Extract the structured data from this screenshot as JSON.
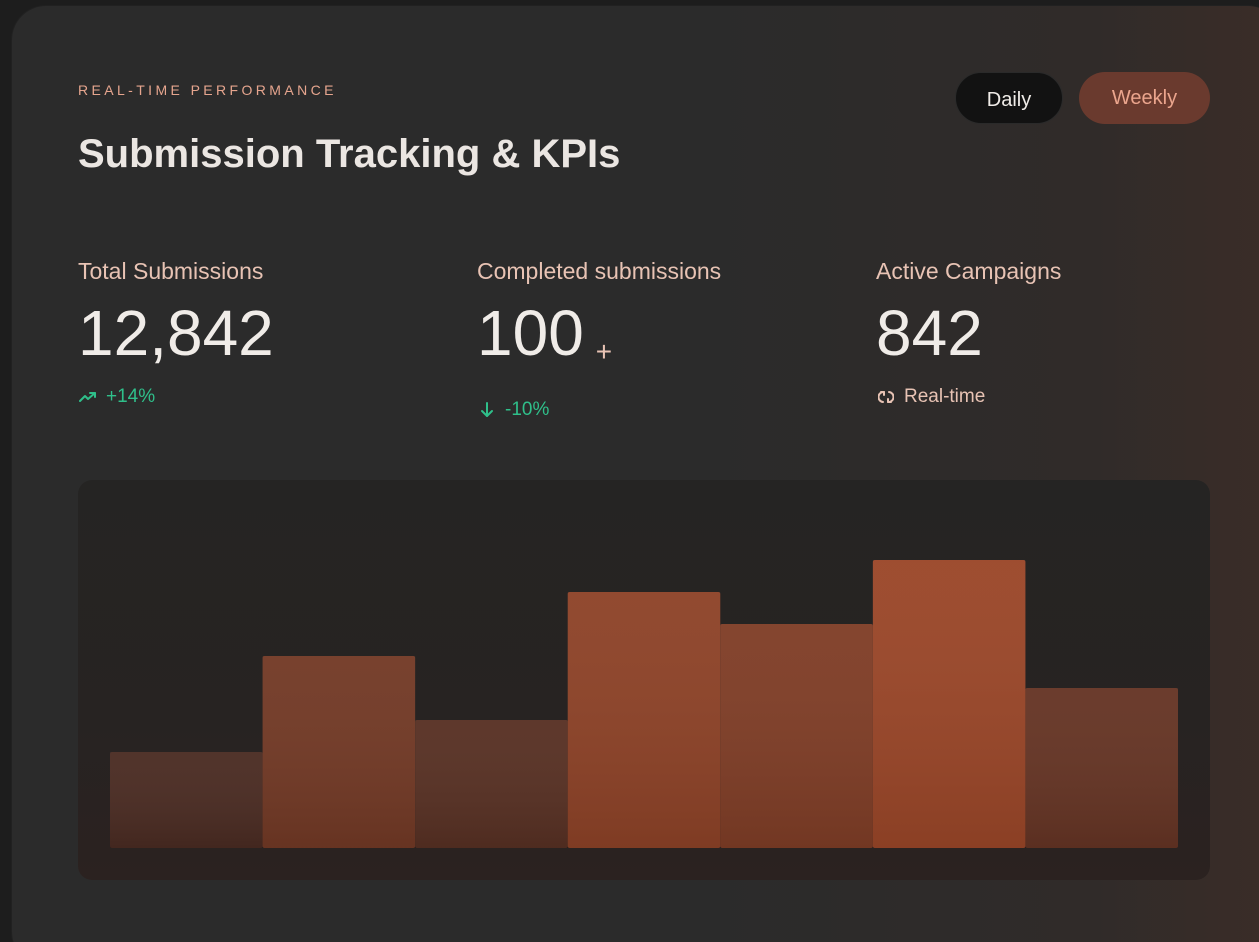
{
  "header": {
    "eyebrow": "REAL-TIME PERFORMANCE",
    "title": "Submission Tracking & KPIs"
  },
  "toggles": [
    {
      "label": "Daily",
      "selected": false
    },
    {
      "label": "Weekly",
      "selected": true
    }
  ],
  "kpis": [
    {
      "label": "Total Submissions",
      "value": "12,842",
      "suffix": "",
      "trend": "+14%",
      "trend_icon": "trending-up-icon",
      "trend_color": "#2fbf8a"
    },
    {
      "label": "Completed submissions",
      "value": "100",
      "suffix": "+",
      "trend": "-10%",
      "trend_icon": "arrow-down-icon",
      "trend_color": "#2fbf8a"
    },
    {
      "label": "Active Campaigns",
      "value": "842",
      "suffix": "",
      "trend": "Real-time",
      "trend_icon": "refresh-icon",
      "trend_color": "#e8c3b4"
    }
  ],
  "colors": {
    "accent": "#e6a58e",
    "bar_base": "#4a2b22",
    "bar_peak": "#9a4628",
    "positive": "#2fbf8a"
  },
  "chart_data": {
    "type": "bar",
    "categories": [
      "",
      "",
      "",
      "",
      "",
      "",
      ""
    ],
    "values": [
      3,
      6,
      4,
      8,
      7,
      9,
      5
    ],
    "title": "",
    "xlabel": "",
    "ylabel": "",
    "ylim": [
      0,
      11.5
    ],
    "grid": false,
    "legend": "none"
  }
}
